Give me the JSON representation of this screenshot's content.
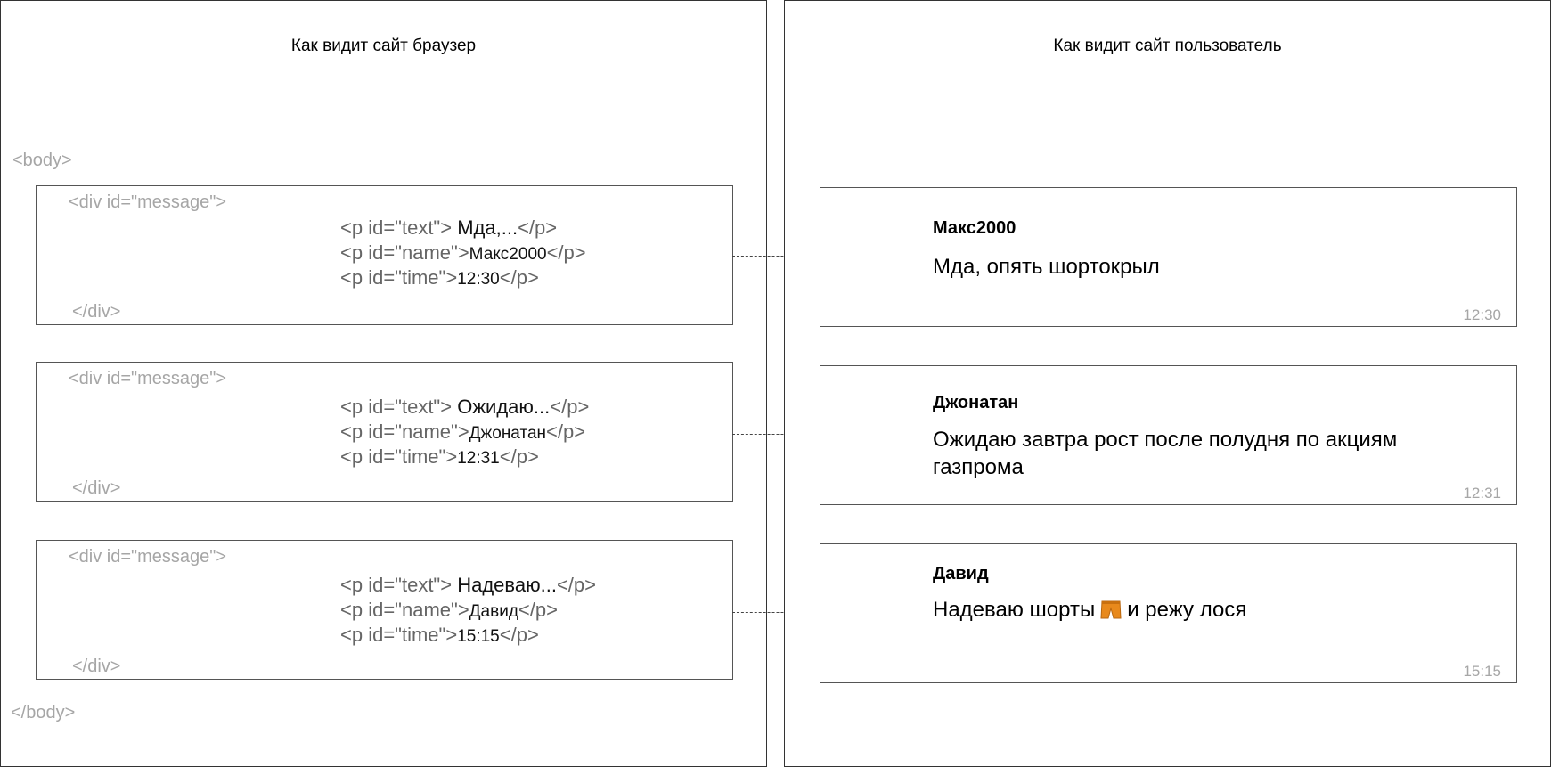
{
  "browser_panel": {
    "title": "Как видит сайт браузер",
    "body_open": "<body>",
    "body_close": "</body>",
    "div_open": "<div id=\"message\">",
    "div_close": "</div>",
    "messages": [
      {
        "text_open": "<p id=\"text\"> ",
        "text_value": "Мда,...",
        "text_close": "</p>",
        "name_open": "<p id=\"name\">",
        "name_value": "Макс2000",
        "name_close": "</p>",
        "time_open": "<p id=\"time\">",
        "time_value": "12:30",
        "time_close": "</p>"
      },
      {
        "text_open": "<p id=\"text\"> ",
        "text_value": "Ожидаю...",
        "text_close": "</p>",
        "name_open": "<p id=\"name\">",
        "name_value": "Джонатан",
        "name_close": "</p>",
        "time_open": "<p id=\"time\">",
        "time_value": "12:31",
        "time_close": "</p>"
      },
      {
        "text_open": "<p id=\"text\"> ",
        "text_value": "Надеваю...",
        "text_close": "</p>",
        "name_open": "<p id=\"name\">",
        "name_value": "Давид",
        "name_close": "</p>",
        "time_open": "<p id=\"time\">",
        "time_value": "15:15",
        "time_close": "</p>"
      }
    ]
  },
  "user_panel": {
    "title": "Как видит сайт пользователь",
    "messages": [
      {
        "name": "Макс2000",
        "text": "Мда, опять шортокрыл",
        "time": "12:30"
      },
      {
        "name": "Джонатан",
        "text": "Ожидаю завтра рост после полудня по акциям газпрома",
        "time": "12:31"
      },
      {
        "name": "Давид",
        "text_before": "Надеваю шорты",
        "emoji": "shorts-icon",
        "text_after": "и режу лося",
        "time": "15:15"
      }
    ]
  },
  "colors": {
    "border": "#333333",
    "tag_gray": "#a6a6a6",
    "code_gray": "#666666",
    "shorts_orange": "#e8891c"
  }
}
